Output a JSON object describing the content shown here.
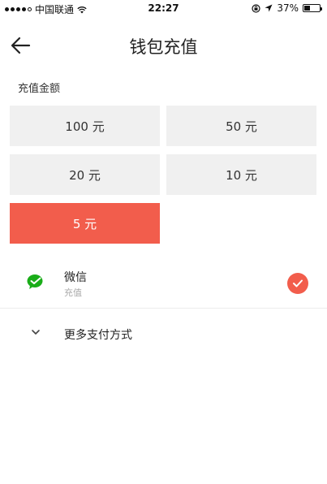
{
  "status_bar": {
    "carrier": "中国联通",
    "time": "22:27",
    "battery": "37%",
    "battery_level": 0.37
  },
  "nav": {
    "title": "钱包充值",
    "back_icon": "arrow-left-icon"
  },
  "section": {
    "label": "充值金额"
  },
  "amounts": [
    {
      "label": "100 元",
      "selected": false
    },
    {
      "label": "50 元",
      "selected": false
    },
    {
      "label": "20 元",
      "selected": false
    },
    {
      "label": "10 元",
      "selected": false
    },
    {
      "label": "5 元",
      "selected": true
    }
  ],
  "payment": {
    "name": "微信",
    "sub": "充值",
    "icon": "wechat-icon",
    "selected": true
  },
  "more": {
    "label": "更多支付方式",
    "icon": "chevron-down-icon"
  },
  "colors": {
    "accent": "#f25d4c",
    "wechat_green": "#1aad19",
    "button_bg": "#f0f0f0"
  }
}
